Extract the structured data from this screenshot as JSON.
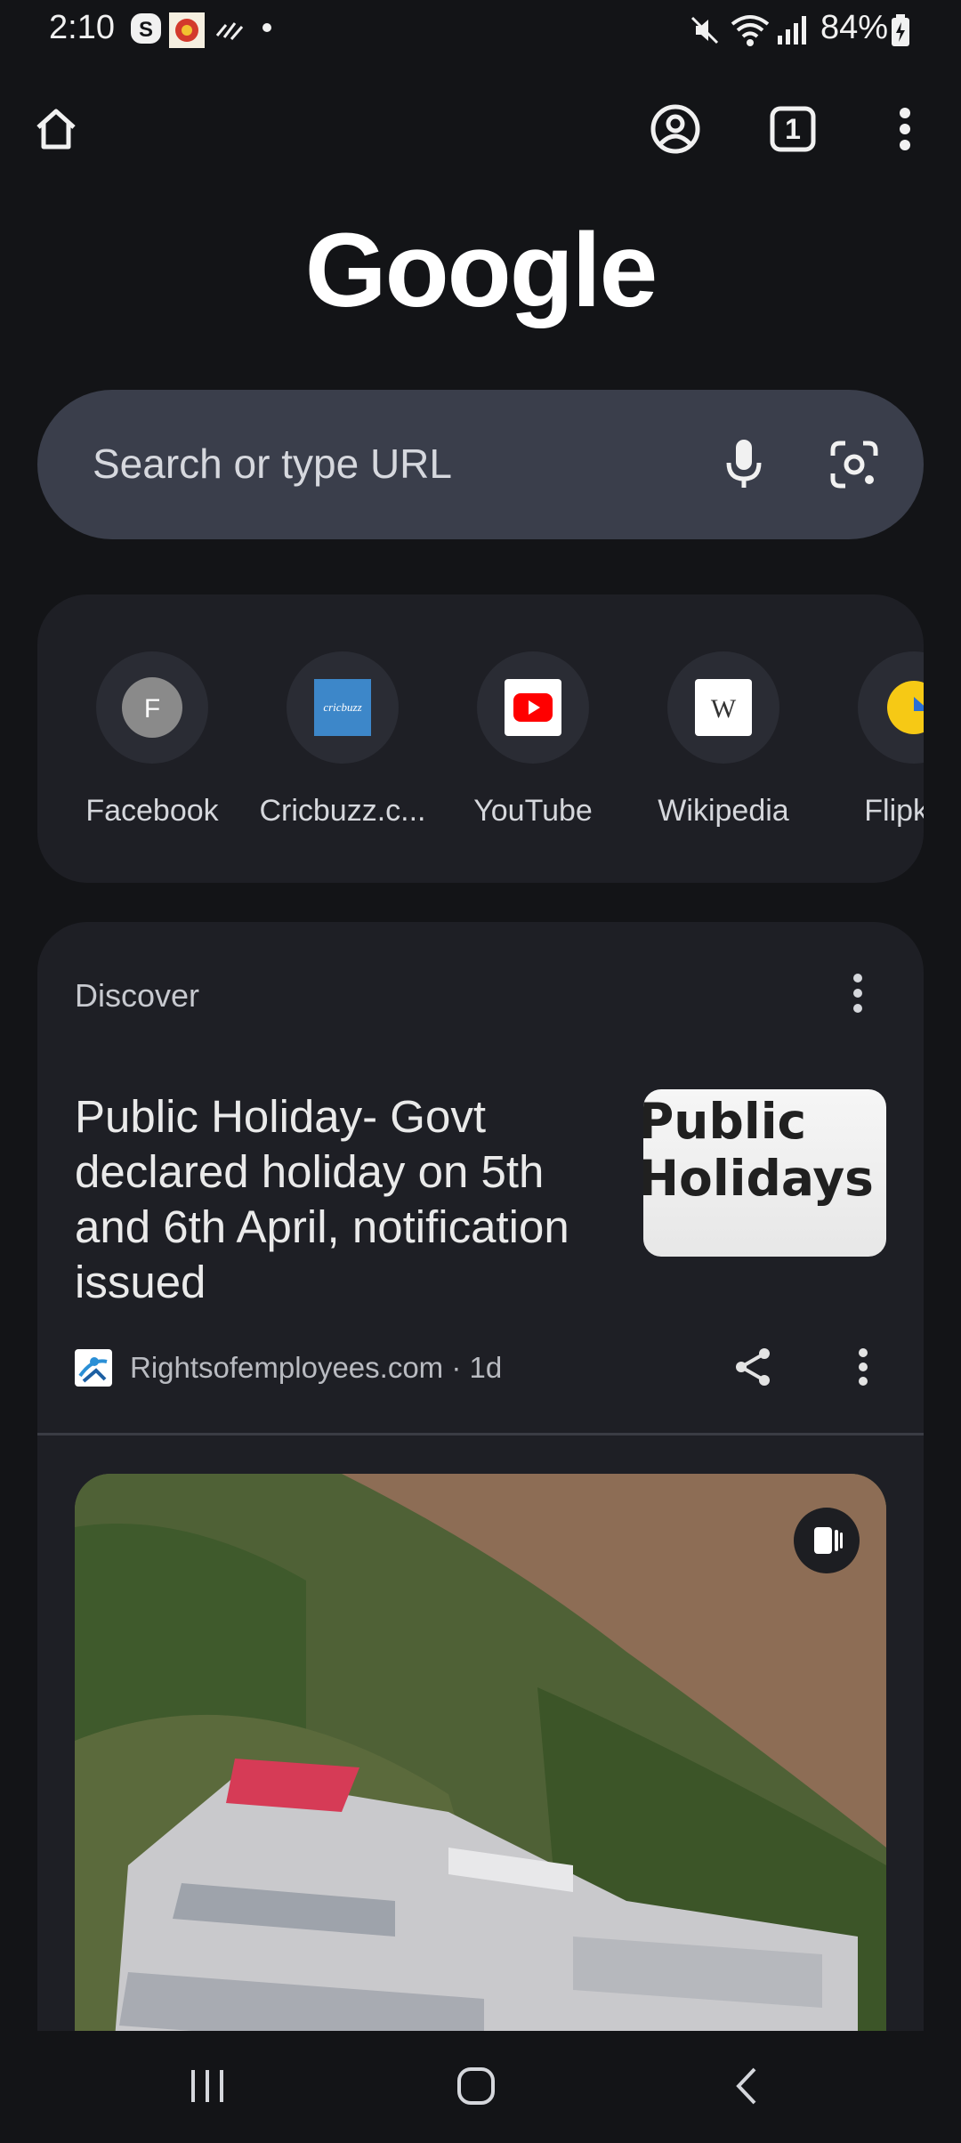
{
  "status_bar": {
    "time": "2:10",
    "battery": "84%"
  },
  "toolbar": {
    "tab_count": "1"
  },
  "logo_text": "Google",
  "search": {
    "placeholder": "Search or type URL"
  },
  "shortcuts": [
    {
      "label": "Facebook",
      "letter": "F",
      "color": "#8a8a8a"
    },
    {
      "label": "Cricbuzz.c...",
      "letter": "cricbuzz",
      "color": "#3d87c9"
    },
    {
      "label": "YouTube",
      "letter": "",
      "color": "#ff0000"
    },
    {
      "label": "Wikipedia",
      "letter": "W",
      "color": "#ffffff"
    },
    {
      "label": "Flipkart",
      "letter": "",
      "color": "#f6c915"
    }
  ],
  "discover": {
    "title": "Discover",
    "article": {
      "title": "Public Holiday- Govt declared holiday on 5th and 6th April, notification issued",
      "thumb_text": "Public Holidays",
      "source": "Rightsofemployees.com · 1d"
    }
  },
  "colors": {
    "background": "#131417",
    "card": "#1e1f25",
    "search_bg": "#3a3e4b"
  }
}
